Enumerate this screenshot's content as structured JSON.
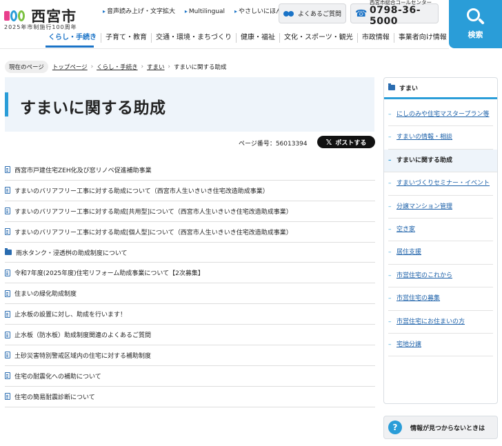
{
  "header": {
    "logo_text": "西宮市",
    "logo_sub": "2025年市制施行100周年",
    "util_links": [
      "音声読み上げ・文字拡大",
      "Multilingual",
      "やさしいにほんご"
    ],
    "faq_label": "よくあるご質問",
    "call_label": "西宮市総合コールセンター",
    "call_number": "0798-36-5000",
    "search_label": "検索"
  },
  "gnav": [
    "くらし・手続き",
    "子育て・教育",
    "交通・環境・まちづくり",
    "健康・福祉",
    "文化・スポーツ・観光",
    "市政情報",
    "事業者向け情報"
  ],
  "breadcrumb": {
    "current_label": "現在のページ",
    "links": [
      "トップページ",
      "くらし・手続き",
      "すまい"
    ],
    "current": "すまいに関する助成"
  },
  "main": {
    "title": "すまいに関する助成",
    "page_number": "ページ番号：56013394",
    "post_label": "ポストする",
    "items": [
      {
        "type": "doc",
        "label": "西宮市戸建住宅ZEH化及び窓リノベ促進補助事業"
      },
      {
        "type": "doc",
        "label": "すまいのバリアフリー工事に対する助成について（西宮市人生いきいき住宅改造助成事業）"
      },
      {
        "type": "doc",
        "label": "すまいのバリアフリー工事に対する助成[共用型]について（西宮市人生いきいき住宅改造助成事業）"
      },
      {
        "type": "doc",
        "label": "すまいのバリアフリー工事に対する助成[個人型]について（西宮市人生いきいき住宅改造助成事業）"
      },
      {
        "type": "folder",
        "label": "雨水タンク・浸透桝の助成制度について"
      },
      {
        "type": "doc",
        "label": "令和7年度(2025年度)住宅リフォーム助成事業について【2次募集】"
      },
      {
        "type": "doc",
        "label": "住まいの緑化助成制度"
      },
      {
        "type": "doc",
        "label": "止水板の設置に対し、助成を行います！"
      },
      {
        "type": "doc",
        "label": "止水板（防水板）助成制度関連のよくあるご質問"
      },
      {
        "type": "doc",
        "label": "土砂災害特別警戒区域内の住宅に対する補助制度"
      },
      {
        "type": "doc",
        "label": "住宅の耐震化への補助について"
      },
      {
        "type": "doc",
        "label": "住宅の簡易耐震診断について"
      }
    ]
  },
  "sidebar": {
    "heading": "すまい",
    "items": [
      {
        "label": "にしのみや住宅マスタープラン等",
        "current": false
      },
      {
        "label": "すまいの情報・相談",
        "current": false
      },
      {
        "label": "すまいに関する助成",
        "current": true
      },
      {
        "label": "すまいづくりセミナー・イベント",
        "current": false
      },
      {
        "label": "分譲マンション管理",
        "current": false
      },
      {
        "label": "空き家",
        "current": false
      },
      {
        "label": "居住支援",
        "current": false
      },
      {
        "label": "市営住宅のこれから",
        "current": false
      },
      {
        "label": "市営住宅の募集",
        "current": false
      },
      {
        "label": "市営住宅にお住まいの方",
        "current": false
      },
      {
        "label": "宅地分譲",
        "current": false
      }
    ],
    "notfound_label": "情報が見つからないときは"
  },
  "colors": {
    "accent": "#2a9dd8",
    "link": "#1a73c7",
    "title_bg": "#eef4fa"
  }
}
